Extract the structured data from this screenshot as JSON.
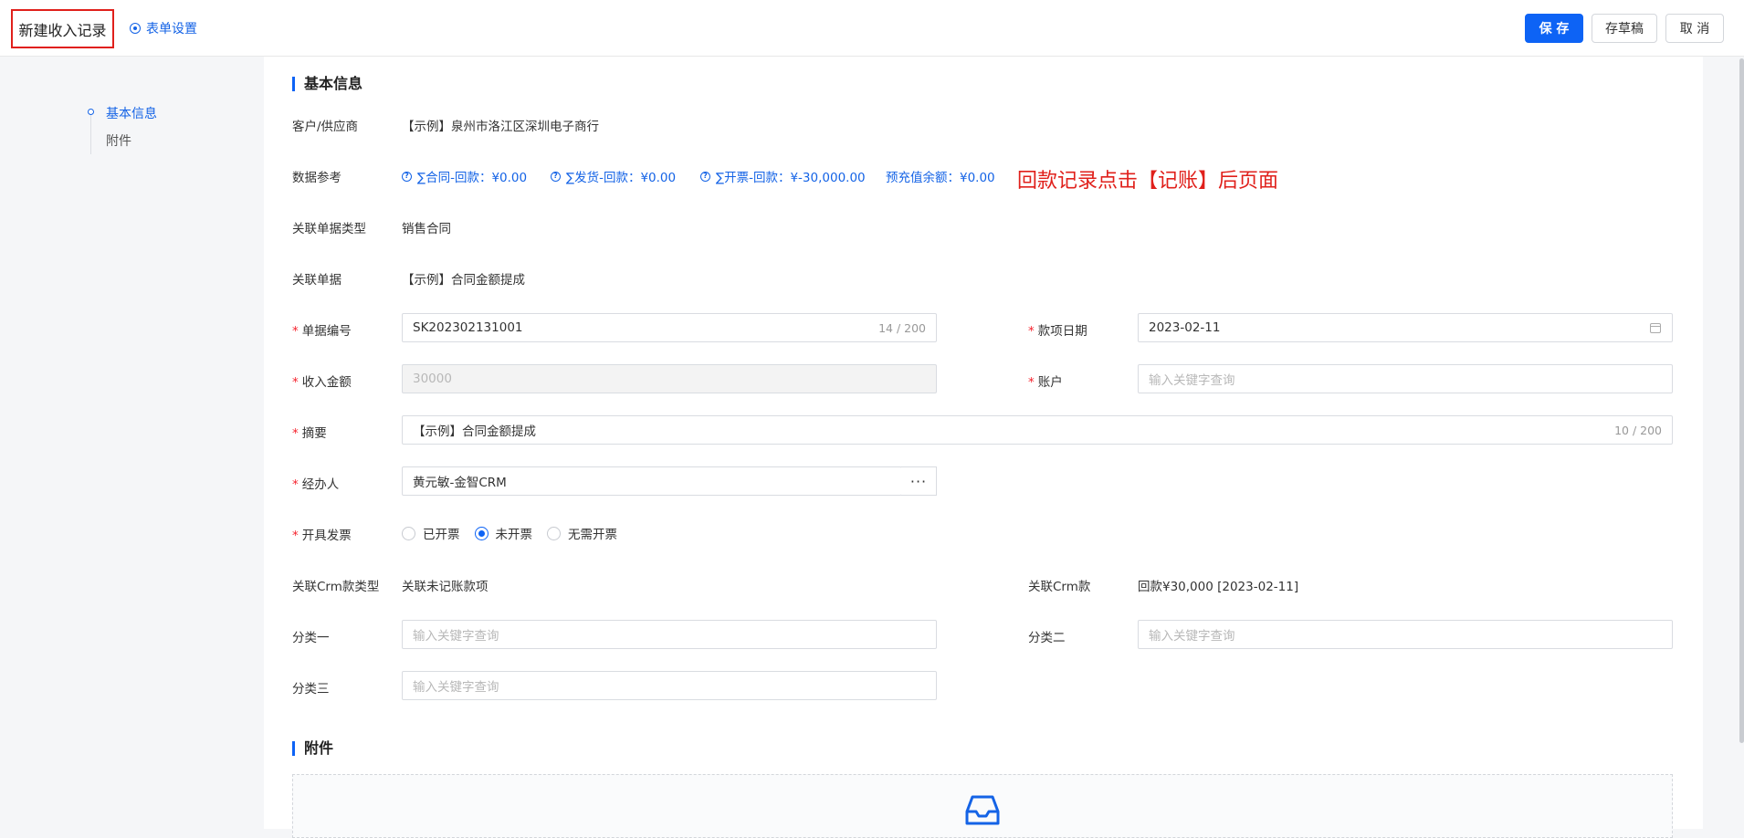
{
  "header": {
    "title": "新建收入记录",
    "form_settings": "表单设置",
    "save": "保 存",
    "draft": "存草稿",
    "cancel": "取 消"
  },
  "sidebar": {
    "items": [
      {
        "label": "基本信息",
        "active": true
      },
      {
        "label": "附件",
        "active": false
      }
    ]
  },
  "sections": {
    "basic": "基本信息",
    "attachments": "附件"
  },
  "annotation": "回款记录点击【记账】后页面",
  "fields": {
    "customer": {
      "label": "客户/供应商",
      "value": "【示例】泉州市洛江区深圳电子商行"
    },
    "data_ref": {
      "label": "数据参考",
      "items": [
        "∑合同-回款：¥0.00",
        "∑发货-回款：¥0.00",
        "∑开票-回款：¥-30,000.00",
        "预充值余额：¥0.00"
      ]
    },
    "related_type": {
      "label": "关联单据类型",
      "value": "销售合同"
    },
    "related_doc": {
      "label": "关联单据",
      "value": "【示例】合同金额提成"
    },
    "doc_no": {
      "label": "单据编号",
      "value": "SK202302131001",
      "counter": "14 / 200"
    },
    "date": {
      "label": "款项日期",
      "value": "2023-02-11"
    },
    "amount": {
      "label": "收入金额",
      "value": "30000"
    },
    "account": {
      "label": "账户",
      "placeholder": "输入关键字查询"
    },
    "summary": {
      "label": "摘要",
      "value": "【示例】合同金额提成",
      "counter": "10 / 200"
    },
    "handler": {
      "label": "经办人",
      "value": "黄元敏-金智CRM",
      "more": "···"
    },
    "invoice": {
      "label": "开具发票",
      "options": [
        "已开票",
        "未开票",
        "无需开票"
      ],
      "selected": "未开票"
    },
    "crm_type": {
      "label": "关联Crm款类型",
      "value": "关联未记账款项"
    },
    "crm": {
      "label": "关联Crm款",
      "value": "回款¥30,000 [2023-02-11]"
    },
    "cat1": {
      "label": "分类一",
      "placeholder": "输入关键字查询"
    },
    "cat2": {
      "label": "分类二",
      "placeholder": "输入关键字查询"
    },
    "cat3": {
      "label": "分类三",
      "placeholder": "输入关键字查询"
    }
  },
  "colors": {
    "primary": "#0d63f5",
    "required": "#f5222d",
    "annotation": "#e0201b"
  }
}
